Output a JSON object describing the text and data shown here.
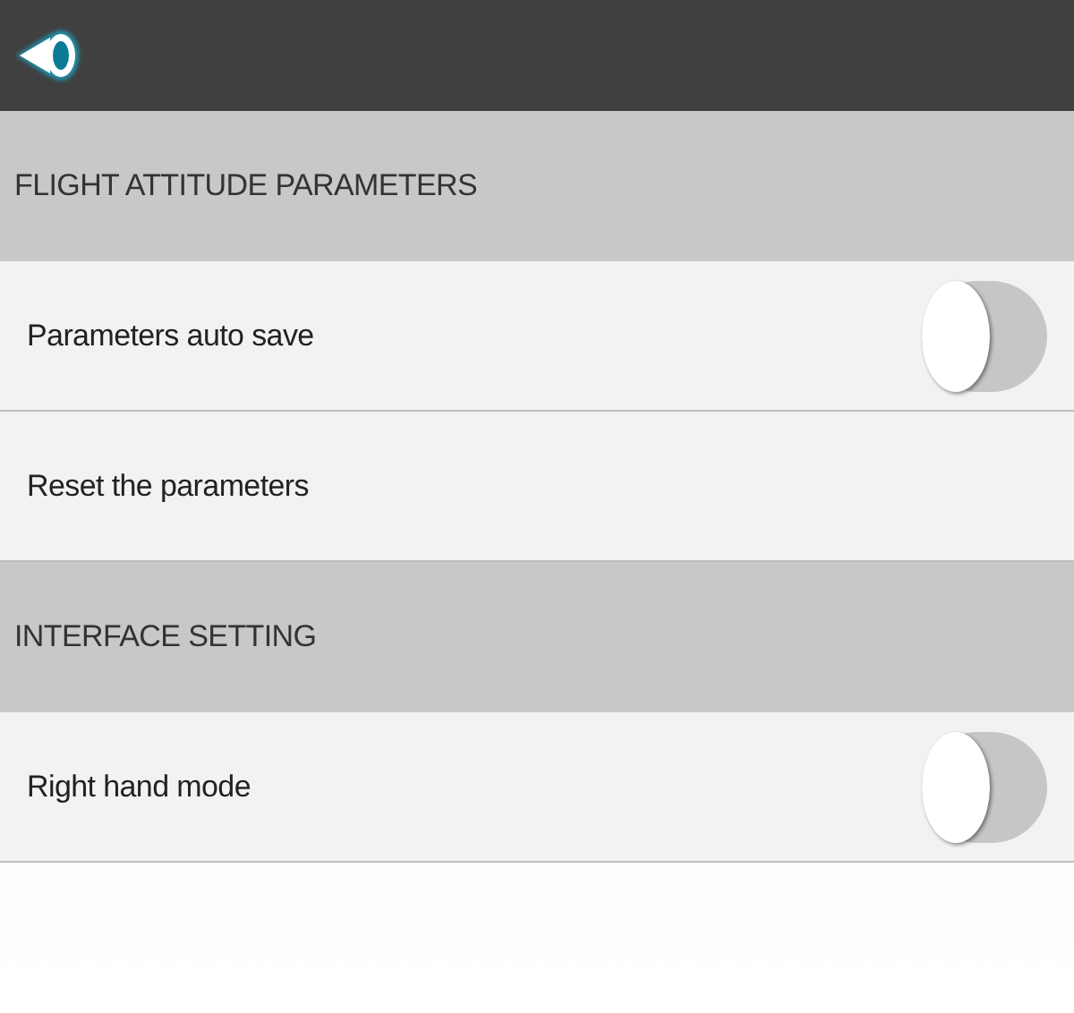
{
  "sections": [
    {
      "title": "FLIGHT ATTITUDE PARAMETERS",
      "items": [
        {
          "kind": "toggle",
          "label": "Parameters auto save",
          "on": false
        },
        {
          "kind": "action",
          "label": "Reset the parameters"
        }
      ]
    },
    {
      "title": "INTERFACE SETTING",
      "items": [
        {
          "kind": "toggle",
          "label": "Right hand mode",
          "on": false
        }
      ]
    }
  ]
}
